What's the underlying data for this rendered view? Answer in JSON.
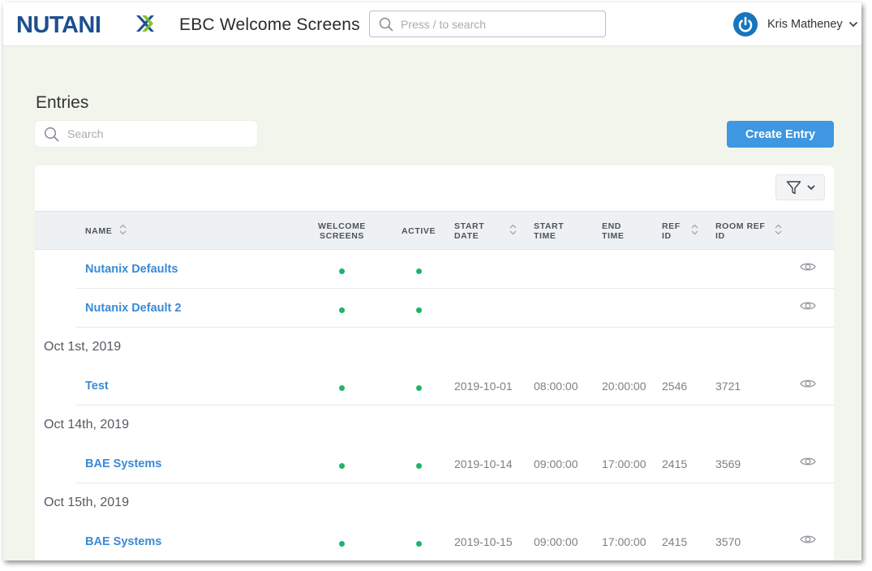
{
  "header": {
    "brand": "NUTANIX",
    "app_title": "EBC Welcome Screens",
    "search_placeholder": "Press / to search",
    "user_name": "Kris Matheney"
  },
  "page": {
    "title": "Entries",
    "search_placeholder": "Search",
    "create_label": "Create Entry"
  },
  "colors": {
    "accent": "#3e97e0",
    "link": "#3a8ad6",
    "status_active": "#1fb46a",
    "brand_navy": "#1d4f91",
    "brand_green": "#78be20"
  },
  "columns": {
    "name": "NAME",
    "welcome_1": "WELCOME",
    "welcome_2": "SCREENS",
    "active": "ACTIVE",
    "start_date_1": "START",
    "start_date_2": "DATE",
    "start_time_1": "START",
    "start_time_2": "TIME",
    "end_time_1": "END",
    "end_time_2": "TIME",
    "ref_id_1": "REF",
    "ref_id_2": "ID",
    "room_ref_1": "ROOM REF",
    "room_ref_2": "ID"
  },
  "rows": [
    {
      "name": "Nutanix Defaults",
      "welcome_screens": true,
      "active": true,
      "start_date": "",
      "start_time": "",
      "end_time": "",
      "ref_id": "",
      "room_ref_id": ""
    },
    {
      "name": "Nutanix Default 2",
      "welcome_screens": true,
      "active": true,
      "start_date": "",
      "start_time": "",
      "end_time": "",
      "ref_id": "",
      "room_ref_id": ""
    },
    {
      "name": "Test",
      "welcome_screens": true,
      "active": true,
      "start_date": "2019-10-01",
      "start_time": "08:00:00",
      "end_time": "20:00:00",
      "ref_id": "2546",
      "room_ref_id": "3721"
    },
    {
      "name": "BAE Systems",
      "welcome_screens": true,
      "active": true,
      "start_date": "2019-10-14",
      "start_time": "09:00:00",
      "end_time": "17:00:00",
      "ref_id": "2415",
      "room_ref_id": "3569"
    },
    {
      "name": "BAE Systems",
      "welcome_screens": true,
      "active": true,
      "start_date": "2019-10-15",
      "start_time": "09:00:00",
      "end_time": "17:00:00",
      "ref_id": "2415",
      "room_ref_id": "3570"
    }
  ],
  "groups": [
    "Oct 1st, 2019",
    "Oct 14th, 2019",
    "Oct 15th, 2019"
  ],
  "icons": {
    "header_search": "search-icon",
    "user": "power-icon",
    "user_menu": "chevron-down-icon",
    "entries_search": "search-icon",
    "filter": "filter-icon",
    "sort": "sort-icon",
    "view": "eye-icon"
  }
}
